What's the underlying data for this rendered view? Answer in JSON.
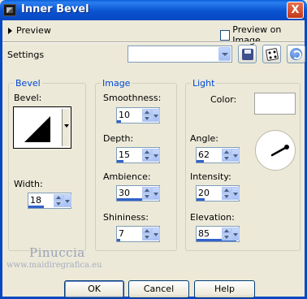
{
  "window": {
    "title": "Inner Bevel",
    "close_label": "X"
  },
  "preview": {
    "toggle_label": "Preview",
    "on_image_label": "Preview on Image",
    "on_image_checked": false
  },
  "settings": {
    "label": "Settings",
    "selected_preset": ""
  },
  "bevel_group": {
    "title": "Bevel",
    "bevel_label": "Bevel:",
    "width_label": "Width:",
    "width_value": "18",
    "width_level": 0.36
  },
  "image_group": {
    "title": "Image",
    "fields": [
      {
        "label": "Smoothness:",
        "value": "10",
        "level": 0.1
      },
      {
        "label": "Depth:",
        "value": "15",
        "level": 0.15
      },
      {
        "label": "Ambience:",
        "value": "30",
        "level": 0.6
      },
      {
        "label": "Shininess:",
        "value": "7",
        "level": 0.07
      }
    ]
  },
  "light_group": {
    "title": "Light",
    "color_label": "Color:",
    "color": "#ffffff",
    "angle_label": "Angle:",
    "angle_value": "62",
    "angle_level": 0.17,
    "intensity_label": "Intensity:",
    "intensity_value": "20",
    "intensity_level": 0.2,
    "elevation_label": "Elevation:",
    "elevation_value": "85",
    "elevation_level": 0.94
  },
  "watermark": {
    "name": "Pinuccia",
    "url": "www.maidiregrafica.eu"
  },
  "buttons": {
    "ok": "OK",
    "cancel": "Cancel",
    "help": "Help"
  },
  "colors": {
    "title_bar": "#0a53d0",
    "group_title": "#0046d5",
    "dialog_bg": "#ece9d8"
  }
}
